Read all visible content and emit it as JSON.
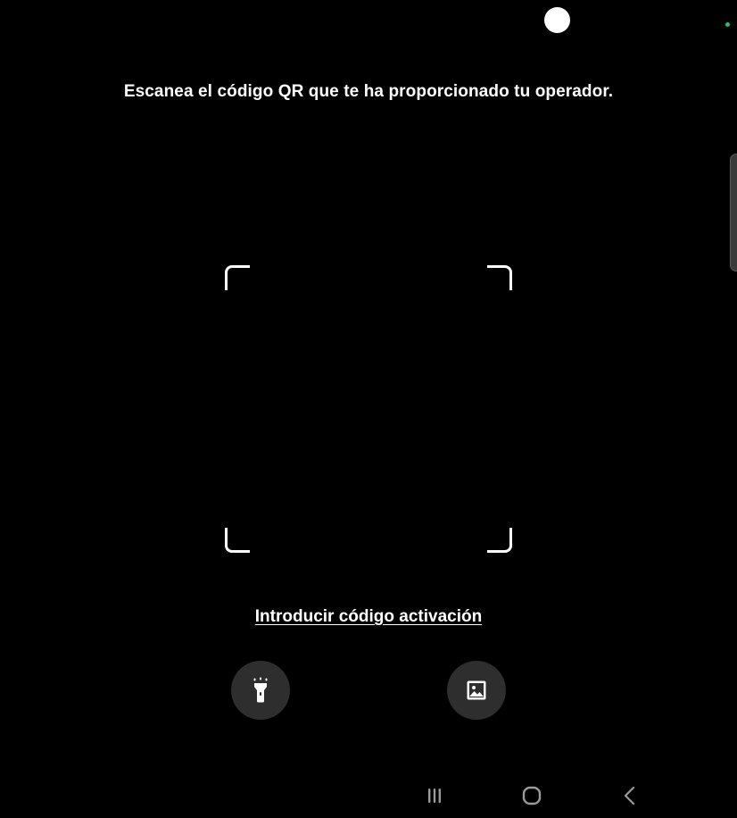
{
  "screen": {
    "instruction": "Escanea el código QR que te ha proporcionado tu operador.",
    "activation_link": "Introducir código activación"
  },
  "controls": {
    "flashlight_icon": "flashlight-icon",
    "gallery_icon": "image-icon"
  },
  "navigation": {
    "recents_icon": "recents-icon",
    "home_icon": "home-icon",
    "back_icon": "back-icon"
  },
  "colors": {
    "background": "#000000",
    "foreground": "#ffffff",
    "button_fill": "#2e2e2e",
    "nav_icon": "#9a9a9a",
    "privacy_indicator": "#22c55e"
  }
}
